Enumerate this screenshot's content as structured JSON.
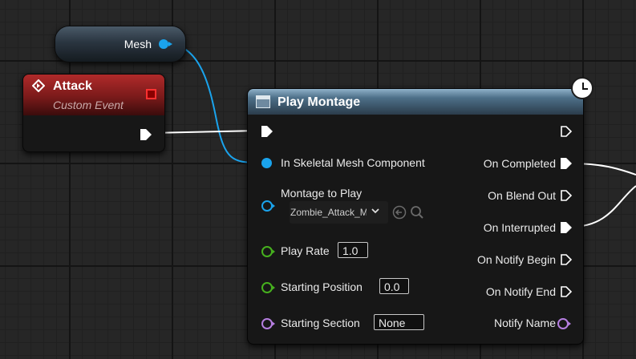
{
  "mesh_node": {
    "label": "Mesh",
    "pin_color": "#1aa3ec"
  },
  "attack_node": {
    "title": "Attack",
    "subtitle": "Custom Event",
    "header_color": "#b02a2a"
  },
  "play_montage": {
    "title": "Play Montage",
    "inputs": {
      "in_skeletal_mesh": "In Skeletal Mesh Component",
      "montage_to_play": "Montage to Play",
      "montage_value": "Zombie_Attack_Montage",
      "play_rate": "Play Rate",
      "play_rate_value": "1.0",
      "starting_position": "Starting Position",
      "starting_position_value": "0.0",
      "starting_section": "Starting Section",
      "starting_section_value": "None"
    },
    "outputs": {
      "on_completed": "On Completed",
      "on_blend_out": "On Blend Out",
      "on_interrupted": "On Interrupted",
      "on_notify_begin": "On Notify Begin",
      "on_notify_end": "On Notify End",
      "notify_name": "Notify Name"
    }
  },
  "icons": {
    "event": "diamond-arrow-icon",
    "function": "function-icon",
    "latent": "clock-icon",
    "browse": "browse-arrow-icon",
    "search": "search-icon"
  },
  "colors": {
    "object_pin": "#1aa3ec",
    "float_pin": "#9fd44a",
    "name_pin": "#b57ee0",
    "exec_pin": "#ffffff",
    "wire_object": "#1aa3ec",
    "wire_exec": "#ffffff"
  }
}
